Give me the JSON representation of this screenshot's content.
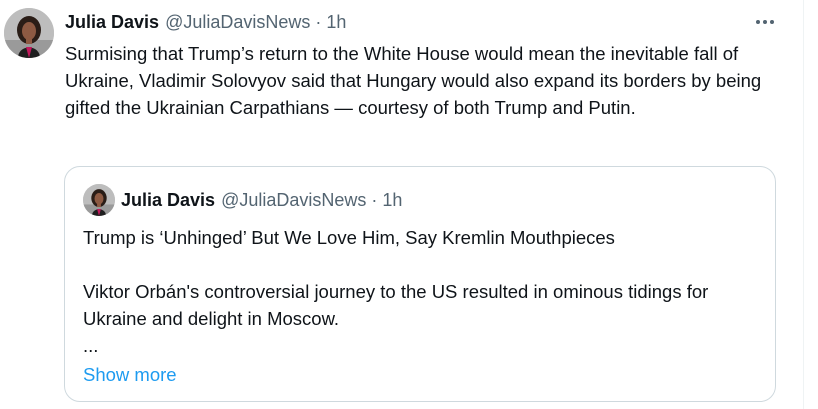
{
  "tweet": {
    "author_name": "Julia Davis",
    "author_handle": "@JuliaDavisNews",
    "separator": "·",
    "time": "1h",
    "text": "Surmising that Trump’s return to the White House would mean the inevitable fall of Ukraine, Vladimir Solovyov said that Hungary would also expand its borders by being gifted the Ukrainian Carpathians — courtesy of both Trump and Putin."
  },
  "quote": {
    "author_name": "Julia Davis",
    "author_handle": "@JuliaDavisNews",
    "separator": "·",
    "time": "1h",
    "headline": "Trump is ‘Unhinged’ But We Love Him, Say Kremlin Mouthpieces",
    "summary": "Viktor Orbán's controversial journey to the US resulted in ominous tidings for Ukraine and delight in Moscow.",
    "ellipsis": "...",
    "show_more_label": "Show more"
  },
  "colors": {
    "text": "#0f1419",
    "secondary": "#536471",
    "link": "#1d9bf0",
    "border": "#cfd9de"
  },
  "icons": {
    "more": "more-horizontal-icon"
  }
}
